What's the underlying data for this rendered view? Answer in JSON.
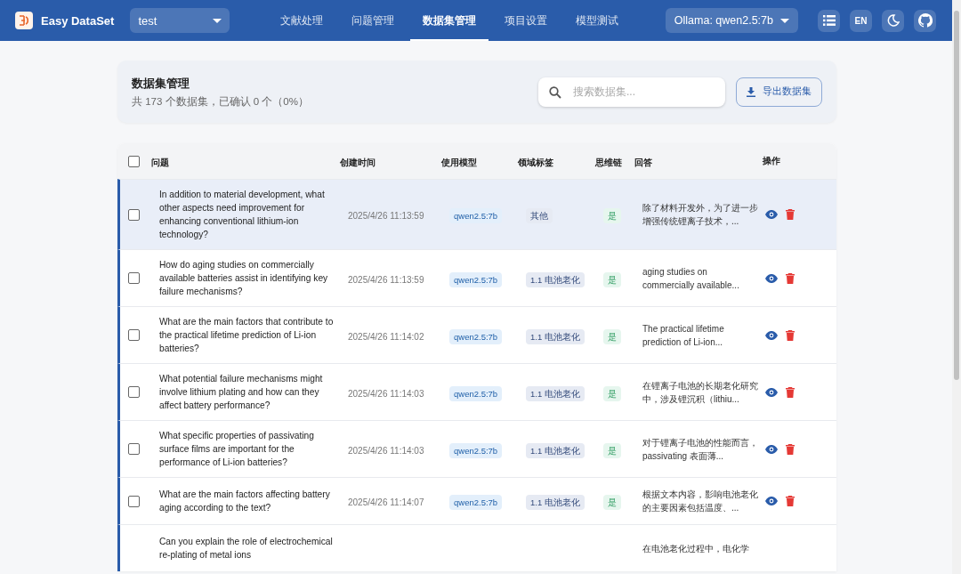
{
  "app": {
    "name": "Easy DataSet"
  },
  "project_select": {
    "value": "test"
  },
  "nav": [
    {
      "label": "文献处理",
      "selected": false
    },
    {
      "label": "问题管理",
      "selected": false
    },
    {
      "label": "数据集管理",
      "selected": true
    },
    {
      "label": "项目设置",
      "selected": false
    },
    {
      "label": "模型测试",
      "selected": false
    }
  ],
  "model_select": {
    "value": "Ollama: qwen2.5:7b"
  },
  "language_button": "EN",
  "summary": {
    "title": "数据集管理",
    "subtitle": "共 173 个数据集，已确认 0 个（0%）"
  },
  "search": {
    "placeholder": "搜索数据集..."
  },
  "export_button": "导出数据集",
  "table": {
    "select_all_checked": false,
    "columns": [
      "问题",
      "创建时间",
      "使用模型",
      "领域标签",
      "思维链",
      "回答",
      "操作"
    ],
    "rows": [
      {
        "question": "In addition to material development, what other aspects need improvement for enhancing conventional lithium-ion technology?",
        "created": "2025/4/26 11:13:59",
        "model": "qwen2.5:7b",
        "tag": "其他",
        "cot": "是",
        "answer": "除了材料开发外，为了进一步增强传统锂离子技术，...",
        "checked": false,
        "selected": true
      },
      {
        "question": "How do aging studies on commercially available batteries assist in identifying key failure mechanisms?",
        "created": "2025/4/26 11:13:59",
        "model": "qwen2.5:7b",
        "tag": "1.1 电池老化",
        "cot": "是",
        "answer": "aging studies on commercially available...",
        "checked": false,
        "selected": false
      },
      {
        "question": "What are the main factors that contribute to the practical lifetime prediction of Li-ion batteries?",
        "created": "2025/4/26 11:14:02",
        "model": "qwen2.5:7b",
        "tag": "1.1 电池老化",
        "cot": "是",
        "answer": "The practical lifetime prediction of Li-ion...",
        "checked": false,
        "selected": false
      },
      {
        "question": "What potential failure mechanisms might involve lithium plating and how can they affect battery performance?",
        "created": "2025/4/26 11:14:03",
        "model": "qwen2.5:7b",
        "tag": "1.1 电池老化",
        "cot": "是",
        "answer": "在锂离子电池的长期老化研究中，涉及锂沉积（lithiu...",
        "checked": false,
        "selected": false
      },
      {
        "question": "What specific properties of passivating surface films are important for the performance of Li-ion batteries?",
        "created": "2025/4/26 11:14:03",
        "model": "qwen2.5:7b",
        "tag": "1.1 电池老化",
        "cot": "是",
        "answer": "对于锂离子电池的性能而言， passivating 表面薄...",
        "checked": false,
        "selected": false
      },
      {
        "question": "What are the main factors affecting battery aging according to the text?",
        "created": "2025/4/26 11:14:07",
        "model": "qwen2.5:7b",
        "tag": "1.1 电池老化",
        "cot": "是",
        "answer": "根据文本内容，影响电池老化的主要因素包括温度、...",
        "checked": false,
        "selected": false
      },
      {
        "question": "Can you explain the role of electrochemical re-plating of metal ions",
        "answer": "在电池老化过程中，电化学",
        "selected": false
      }
    ]
  }
}
